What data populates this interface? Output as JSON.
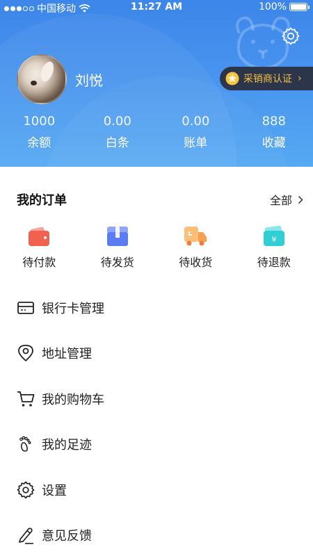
{
  "status_bar": {
    "carrier": "中国移动",
    "time": "11:27 AM",
    "battery": "100%"
  },
  "profile": {
    "name": "刘悦",
    "cert_label": "采销商认证",
    "stats": [
      {
        "value": "1000",
        "label": "余额"
      },
      {
        "value": "0.00",
        "label": "白条"
      },
      {
        "value": "0.00",
        "label": "账单"
      },
      {
        "value": "888",
        "label": "收藏"
      }
    ]
  },
  "orders": {
    "title": "我的订单",
    "all_label": "全部",
    "tabs": [
      {
        "label": "待付款",
        "icon": "wallet-icon",
        "color": "#f2604f"
      },
      {
        "label": "待发货",
        "icon": "package-icon",
        "color": "#5b7cf2"
      },
      {
        "label": "待收货",
        "icon": "truck-icon",
        "color": "#f7a052"
      },
      {
        "label": "待退款",
        "icon": "refund-icon",
        "color": "#2fcfd3"
      }
    ]
  },
  "menu": {
    "items": [
      {
        "label": "银行卡管理",
        "icon": "bank-card-icon"
      },
      {
        "label": "地址管理",
        "icon": "location-pin-icon"
      },
      {
        "label": "我的购物车",
        "icon": "cart-icon"
      },
      {
        "label": "我的足迹",
        "icon": "footprint-icon"
      },
      {
        "label": "设置",
        "icon": "gear-icon"
      },
      {
        "label": "意见反馈",
        "icon": "pen-icon"
      }
    ]
  },
  "colors": {
    "header_gradient_top": "#3d86ea",
    "header_gradient_bottom": "#56a9f3",
    "cert_text": "#f5c146"
  }
}
